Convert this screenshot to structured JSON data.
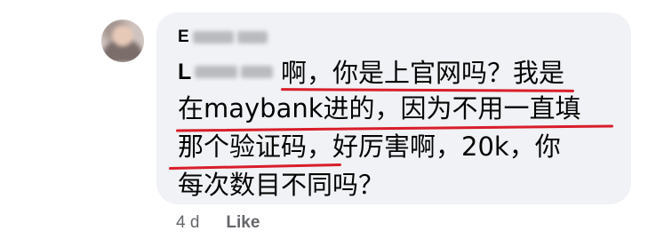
{
  "comment": {
    "author_initial": "E",
    "mention_initial": "L",
    "lines": [
      "啊，你是上官网吗？我是",
      "在maybank进的，因为不用一直填",
      "那个验证码，好厉害啊，20k，你",
      "每次数目不同吗？"
    ],
    "highlight_color": "#d91e2a"
  },
  "meta": {
    "timestamp": "4 d",
    "like_label": "Like"
  }
}
